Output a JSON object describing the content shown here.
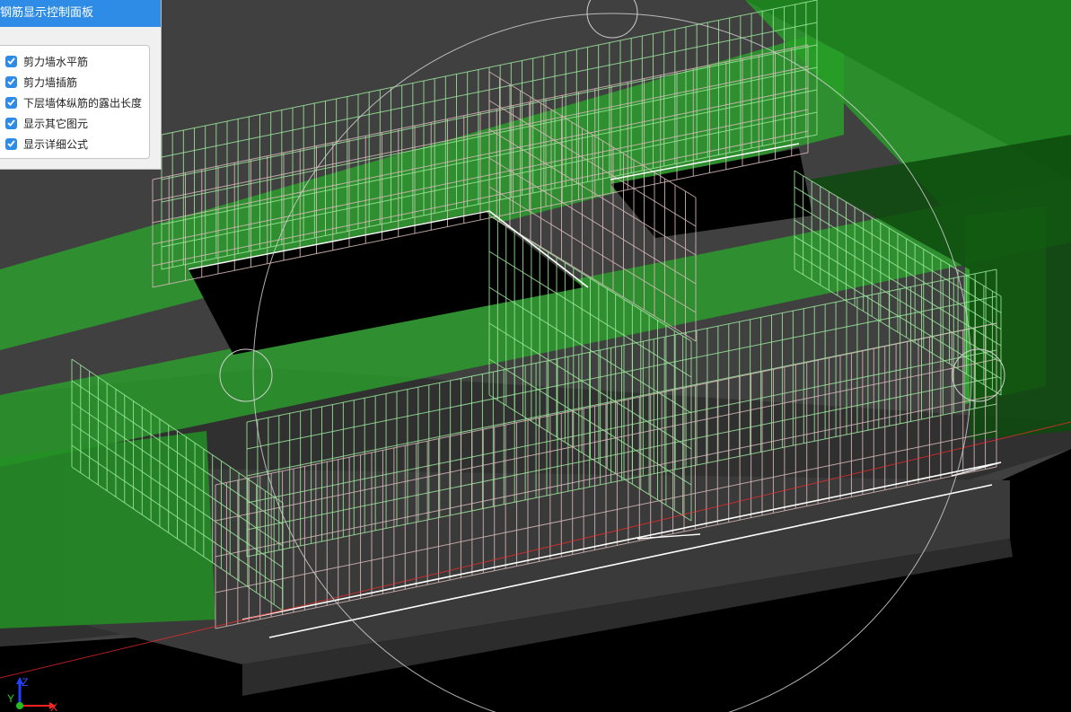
{
  "panel": {
    "title": "钢筋显示控制面板",
    "options": [
      {
        "label": "剪力墙水平筋",
        "checked": true
      },
      {
        "label": "剪力墙插筋",
        "checked": true
      },
      {
        "label": "下层墙体纵筋的露出长度",
        "checked": true
      },
      {
        "label": "显示其它图元",
        "checked": true
      },
      {
        "label": "显示详细公式",
        "checked": true
      }
    ]
  },
  "axis": {
    "x": "X",
    "y": "Y",
    "z": "Z"
  },
  "colors": {
    "accent": "#2e8be6",
    "background": "#000000",
    "slab": "#404040",
    "concrete_green": "#2fae2f",
    "rebar_green": "#9be89b",
    "rebar_white": "#ffffff",
    "rebar_pink": "#d7b9b9",
    "axis_x": "#ff2020",
    "axis_y": "#20c020",
    "axis_z": "#2040ff"
  }
}
